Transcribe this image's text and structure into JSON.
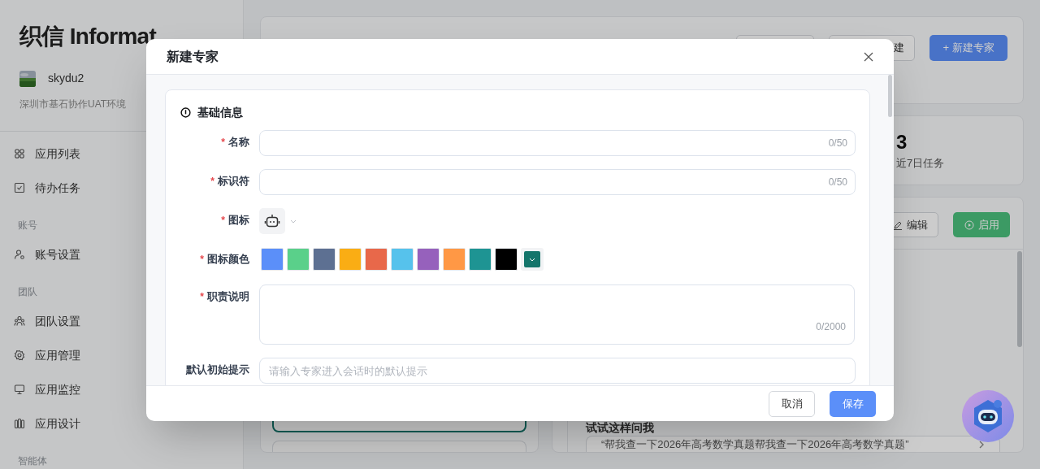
{
  "sidebar": {
    "logo": "织信 Informat",
    "user": {
      "name": "skydu2",
      "org": "深圳市基石协作UAT环境"
    },
    "items": [
      {
        "kind": "item",
        "label": "应用列表"
      },
      {
        "kind": "item",
        "label": "待办任务"
      },
      {
        "kind": "section",
        "label": "账号"
      },
      {
        "kind": "item",
        "label": "账号设置"
      },
      {
        "kind": "section",
        "label": "团队"
      },
      {
        "kind": "item",
        "label": "团队设置"
      },
      {
        "kind": "item",
        "label": "应用管理"
      },
      {
        "kind": "item",
        "label": "应用监控"
      },
      {
        "kind": "item",
        "label": "应用设计"
      },
      {
        "kind": "section",
        "label": "智能体"
      }
    ]
  },
  "header": {
    "buttons": [
      {
        "kind": "outline",
        "label": "建"
      },
      {
        "kind": "primary",
        "label": "+ 新建专家"
      }
    ]
  },
  "stats": {
    "value": "3",
    "label": "近7日任务"
  },
  "detail": {
    "buttons": [
      {
        "kind": "outline",
        "label": "编辑"
      },
      {
        "kind": "success",
        "label": "启用"
      }
    ],
    "suggest_title": "试试这样问我",
    "suggestion": "“帮我查一下2026年高考数学真题帮我查一下2026年高考数学真题”"
  },
  "dialog": {
    "title": "新建专家",
    "section_title": "基础信息",
    "required_mark": "*",
    "fields": [
      {
        "kind": "text",
        "label": "名称",
        "required": true,
        "counter": "0/50"
      },
      {
        "kind": "text",
        "label": "标识符",
        "required": true,
        "counter": "0/50"
      },
      {
        "kind": "icon",
        "label": "图标",
        "required": true
      },
      {
        "kind": "colors",
        "label": "图标颜色",
        "required": true,
        "swatches": [
          {
            "color": "#5b8ff9"
          },
          {
            "color": "#5ad08a"
          },
          {
            "color": "#5d7092"
          },
          {
            "color": "#faad14"
          },
          {
            "color": "#e8684a"
          },
          {
            "color": "#56c2ec"
          },
          {
            "color": "#9661bc"
          },
          {
            "color": "#ff9845"
          },
          {
            "color": "#1e9493"
          },
          {
            "color": "#000000"
          }
        ],
        "custom": {
          "color": "#14756b"
        }
      },
      {
        "kind": "textarea",
        "label": "职责说明",
        "required": true,
        "counter": "0/2000"
      },
      {
        "kind": "text",
        "label": "默认初始提示",
        "required": false,
        "placeholder": "请输入专家进入会话时的默认提示"
      }
    ],
    "buttons": [
      {
        "kind": "default",
        "label": "取消"
      },
      {
        "kind": "primary",
        "label": "保存"
      }
    ]
  }
}
